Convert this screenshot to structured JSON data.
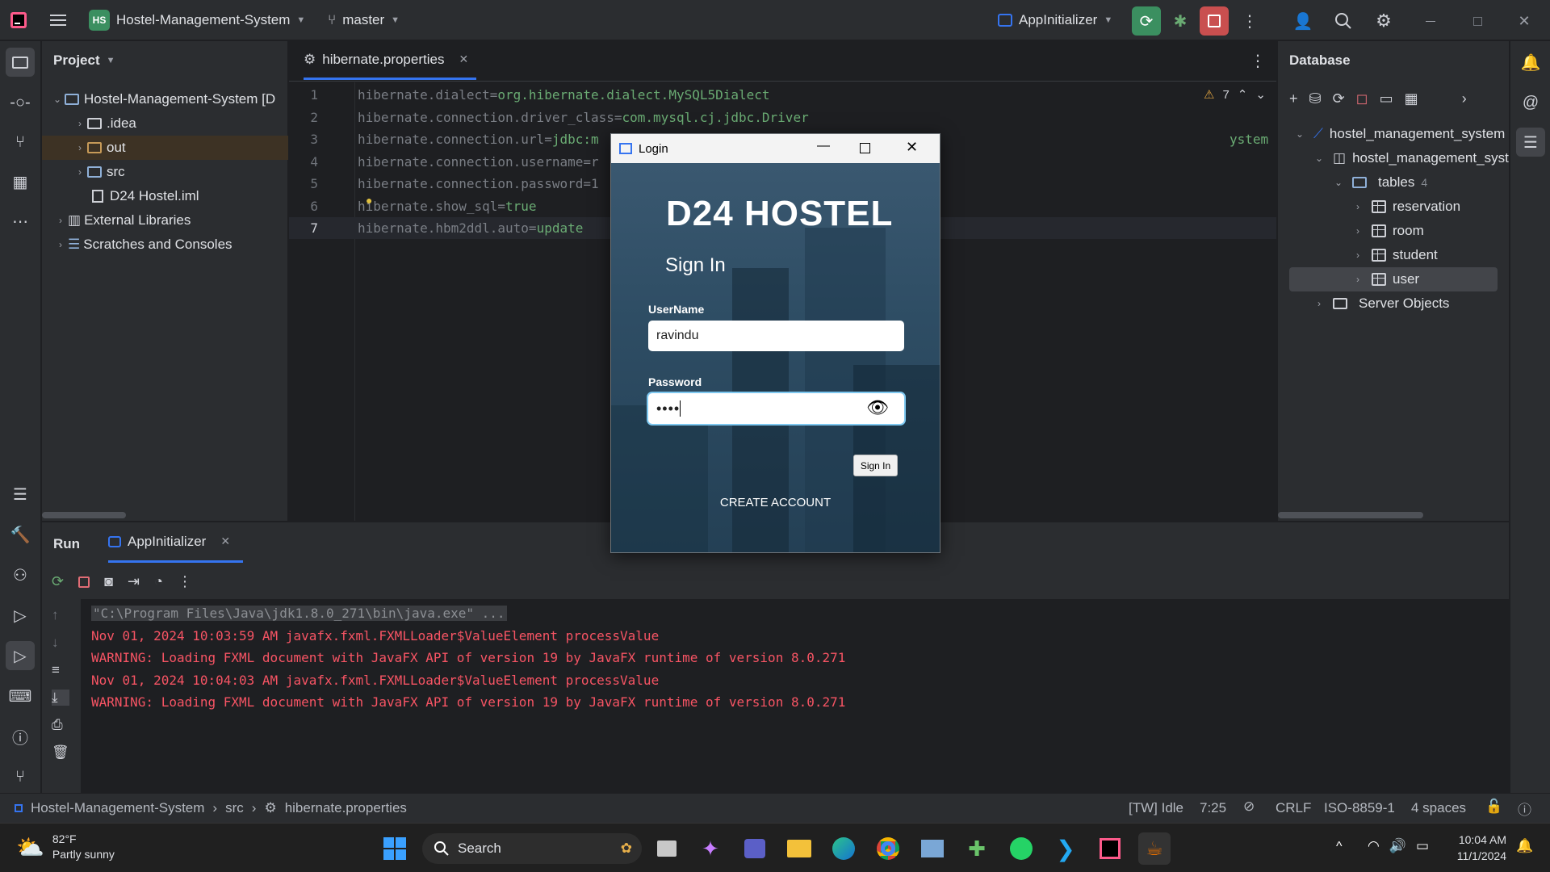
{
  "titlebar": {
    "project_badge": "HS",
    "project_name": "Hostel-Management-System",
    "branch": "master",
    "run_config": "AppInitializer"
  },
  "project_panel": {
    "title": "Project",
    "items": [
      {
        "label": "Hostel-Management-System [D",
        "type": "module"
      },
      {
        "label": ".idea",
        "type": "folder"
      },
      {
        "label": "out",
        "type": "folder-excluded"
      },
      {
        "label": "src",
        "type": "folder-source"
      },
      {
        "label": "D24 Hostel.iml",
        "type": "file"
      },
      {
        "label": "External Libraries",
        "type": "library"
      },
      {
        "label": "Scratches and Consoles",
        "type": "scratches"
      }
    ]
  },
  "editor": {
    "tab": "hibernate.properties",
    "warnings": "7",
    "lines": [
      {
        "num": "1",
        "key": "hibernate.dialect=",
        "val": "org.hibernate.dialect.MySQL5Dialect"
      },
      {
        "num": "2",
        "key": "hibernate.connection.driver_class=",
        "val": "com.mysql.cj.jdbc.Driver"
      },
      {
        "num": "3",
        "key": "hibernate.connection.url=",
        "val": "jdbc:m",
        "tail": "ystem"
      },
      {
        "num": "4",
        "key": "hibernate.connection.username=r",
        "val": ""
      },
      {
        "num": "5",
        "key": "hibernate.connection.password=1",
        "val": ""
      },
      {
        "num": "6",
        "key": "hibernate.show_sql=",
        "val": "true"
      },
      {
        "num": "7",
        "key": "hibernate.hbm2ddl.auto=",
        "val": "update"
      }
    ]
  },
  "database_panel": {
    "title": "Database",
    "items": [
      {
        "label": "hostel_management_system"
      },
      {
        "label": "hostel_management_syst"
      },
      {
        "label": "tables",
        "count": "4"
      },
      {
        "label": "reservation"
      },
      {
        "label": "room"
      },
      {
        "label": "student"
      },
      {
        "label": "user"
      },
      {
        "label": "Server Objects"
      }
    ]
  },
  "run_panel": {
    "title": "Run",
    "tab": "AppInitializer",
    "console": [
      "\"C:\\Program Files\\Java\\jdk1.8.0_271\\bin\\java.exe\" ...",
      "Nov 01, 2024 10:03:59 AM javafx.fxml.FXMLLoader$ValueElement processValue",
      "WARNING: Loading FXML document with JavaFX API of version 19 by JavaFX runtime of version 8.0.271",
      "Nov 01, 2024 10:04:03 AM javafx.fxml.FXMLLoader$ValueElement processValue",
      "WARNING: Loading FXML document with JavaFX API of version 19 by JavaFX runtime of version 8.0.271"
    ]
  },
  "statusbar": {
    "crumbs": [
      "Hostel-Management-System",
      "src",
      "hibernate.properties"
    ],
    "tw": "[TW] Idle",
    "position": "7:25",
    "line_sep": "CRLF",
    "encoding": "ISO-8859-1",
    "indent": "4 spaces"
  },
  "login": {
    "window_title": "Login",
    "brand": "D24 HOSTEL",
    "heading": "Sign In",
    "username_label": "UserName",
    "username_value": "ravindu",
    "password_label": "Password",
    "password_value": "••••",
    "signin_button": "Sign In",
    "create_account": "CREATE ACCOUNT"
  },
  "taskbar": {
    "temp": "82°F",
    "weather": "Partly sunny",
    "search": "Search",
    "time": "10:04 AM",
    "date": "11/1/2024"
  },
  "colors": {
    "accent": "#3574f0",
    "run_green": "#3b8f60",
    "stop_red": "#c94f4f",
    "error_text": "#f75464"
  }
}
